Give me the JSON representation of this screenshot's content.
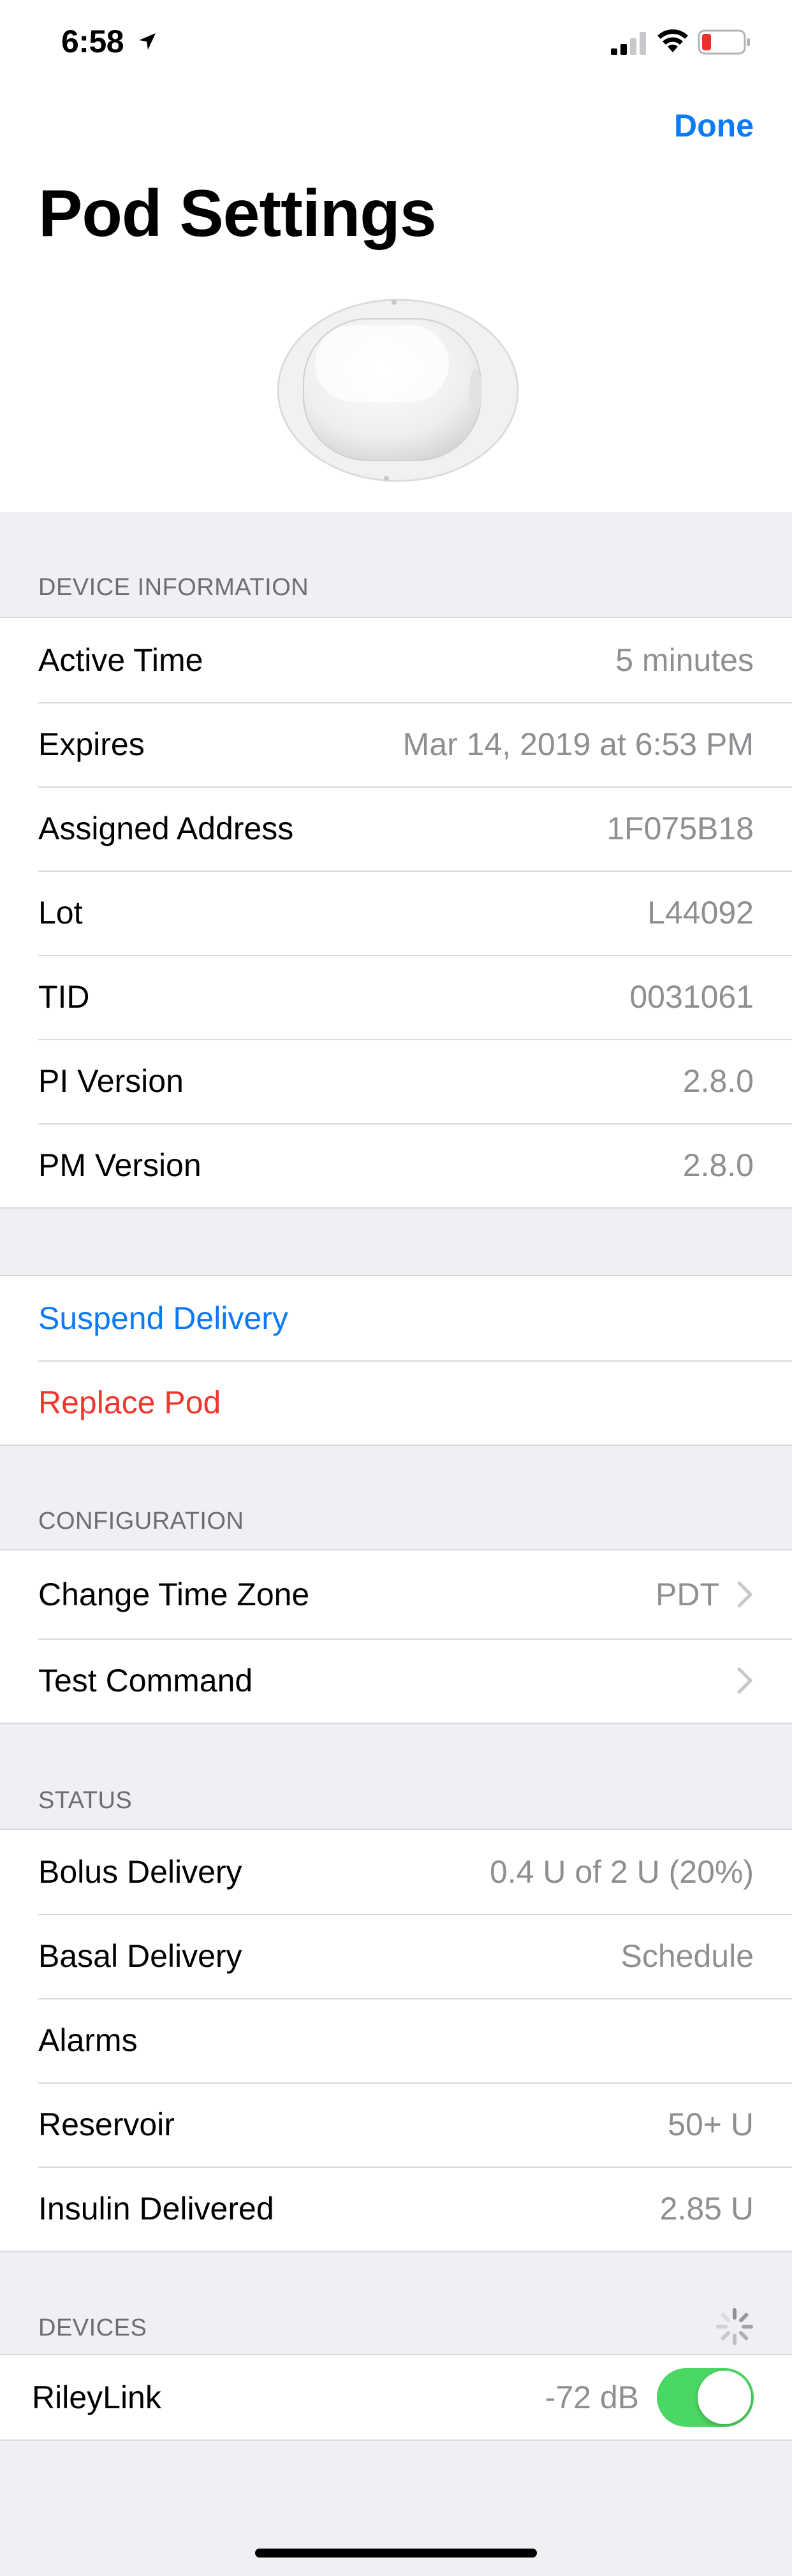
{
  "status_bar": {
    "time": "6:58",
    "icons": [
      "location-arrow-icon",
      "cellular-signal-icon",
      "wifi-icon",
      "battery-low-icon"
    ],
    "battery_color": "#e8322b"
  },
  "nav": {
    "done_label": "Done"
  },
  "title": "Pod Settings",
  "device_information": {
    "header": "DEVICE INFORMATION",
    "rows": [
      {
        "label": "Active Time",
        "value": "5 minutes"
      },
      {
        "label": "Expires",
        "value": "Mar 14, 2019 at 6:53 PM"
      },
      {
        "label": "Assigned Address",
        "value": "1F075B18"
      },
      {
        "label": "Lot",
        "value": "L44092"
      },
      {
        "label": "TID",
        "value": "0031061"
      },
      {
        "label": "PI Version",
        "value": "2.8.0"
      },
      {
        "label": "PM Version",
        "value": "2.8.0"
      }
    ]
  },
  "actions": {
    "suspend_label": "Suspend Delivery",
    "replace_label": "Replace Pod"
  },
  "configuration": {
    "header": "CONFIGURATION",
    "time_zone_label": "Change Time Zone",
    "time_zone_value": "PDT",
    "test_command_label": "Test Command"
  },
  "status": {
    "header": "STATUS",
    "rows": [
      {
        "label": "Bolus Delivery",
        "value": "0.4 U of 2 U (20%)"
      },
      {
        "label": "Basal Delivery",
        "value": "Schedule"
      },
      {
        "label": "Alarms",
        "value": ""
      },
      {
        "label": "Reservoir",
        "value": "50+ U"
      },
      {
        "label": "Insulin Delivered",
        "value": "2.85 U"
      }
    ]
  },
  "devices": {
    "header": "DEVICES",
    "rileylink_label": "RileyLink",
    "rileylink_signal": "-72 dB",
    "rileylink_enabled": true
  },
  "colors": {
    "accent": "#0a7af6",
    "destructive": "#f2352d",
    "toggle_on": "#4bd763",
    "secondary_text": "#8e8e93",
    "grouped_background": "#efeff4"
  }
}
